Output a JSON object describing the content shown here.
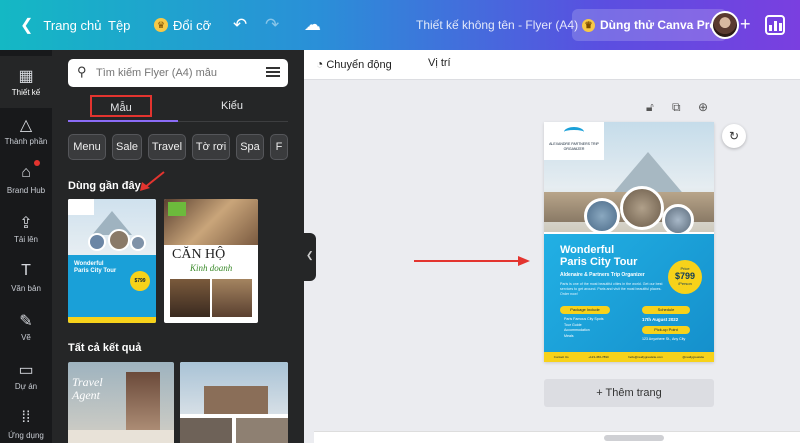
{
  "topbar": {
    "back_label": "Trang chủ",
    "file_label": "Tệp",
    "resize_label": "Đổi cỡ",
    "doc_title": "Thiết kế không tên - Flyer (A4)",
    "pro_label": "Dùng thử Canva Pro"
  },
  "rail": [
    {
      "label": "Thiết kế",
      "icon": "layout-icon"
    },
    {
      "label": "Thành phần",
      "icon": "shapes-icon"
    },
    {
      "label": "Brand Hub",
      "icon": "brand-hub-icon"
    },
    {
      "label": "Tải lên",
      "icon": "upload-icon"
    },
    {
      "label": "Văn bản",
      "icon": "text-icon"
    },
    {
      "label": "Vẽ",
      "icon": "draw-icon"
    },
    {
      "label": "Dự án",
      "icon": "folder-icon"
    },
    {
      "label": "Ứng dụng",
      "icon": "apps-icon"
    }
  ],
  "panel": {
    "search_placeholder": "Tìm kiếm Flyer (A4) mẫu",
    "tab_templates": "Mẫu",
    "tab_styles": "Kiểu",
    "chips": [
      "Menu",
      "Sale",
      "Travel",
      "Tờ rơi",
      "Spa",
      "F"
    ],
    "recent_title": "Dùng gần đây",
    "all_results_title": "Tất cả kết quả",
    "thumb2_title": "CĂN HỘ",
    "thumb2_sub": "Kinh doanh",
    "thumb3_text": "Travel Agent"
  },
  "toolbar": {
    "animate": "Chuyển động",
    "position": "Vị trí"
  },
  "flyer": {
    "brand": "ALEXANDRE PARTNERS TRIP ORGANIZER",
    "headline1": "Wonderful",
    "headline2": "Paris City Tour",
    "subhead": "Aldenaire & Partners Trip Organizer",
    "body": "Paris is one of the most beautiful cities in the world. Get our best services to get around. Paris and visit the most beautiful places. Order now!",
    "price_label": "Price",
    "price": "$799",
    "price_note": "/Person",
    "package_label": "Package Include",
    "packages": [
      "Paris Famous City Spots",
      "Tour Guide",
      "Accommodation",
      "Meals"
    ],
    "schedule_label": "Schedule",
    "date": "17th August 2022",
    "pickup_label": "Pick-up Point",
    "address": "123 Anywhere St., Any City",
    "footer": [
      "Contact Us",
      "+123-456-7890",
      "hello@reallygreatsite.com",
      "@reallygreatsite"
    ]
  },
  "canvas": {
    "add_page": "+ Thêm trang"
  }
}
